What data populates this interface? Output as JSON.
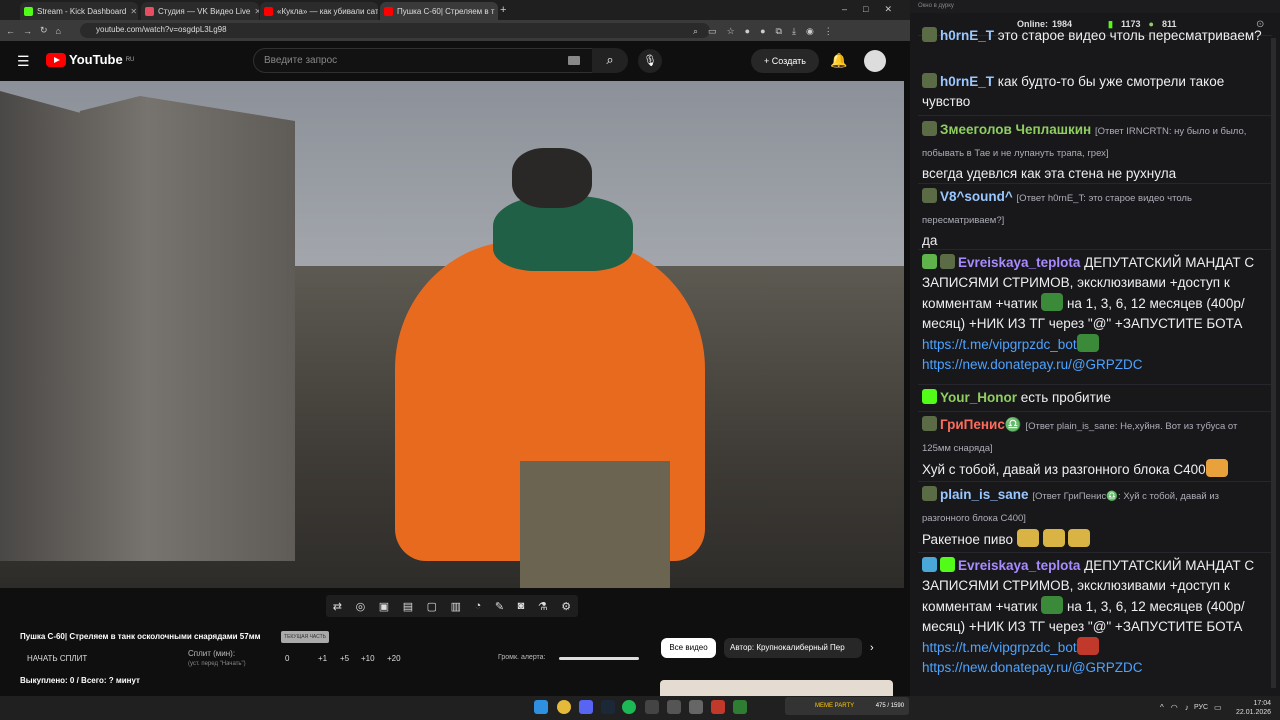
{
  "browser": {
    "tabs": [
      {
        "label": "Stream - Kick Dashboard",
        "color": "#53fc18",
        "active": false
      },
      {
        "label": "Студия — VK Видео Live",
        "color": "#e84d61",
        "active": false
      },
      {
        "label": "«Кукла» — как убивали сатир",
        "color": "#ff0000",
        "active": false
      },
      {
        "label": "Пушка С-60| Стреляем в т",
        "color": "#ff0000",
        "active": true
      }
    ],
    "url": "youtube.com/watch?v=osgdpL3Lg98"
  },
  "youtube": {
    "logo": "YouTube",
    "region": "RU",
    "search_placeholder": "Введите запрос",
    "create_label": "Создать"
  },
  "panel": {
    "title": "Пушка С-60| Стреляем в танк осколочными снарядами 57мм",
    "badge": "ТЕКУЩАЯ ЧАСТЬ",
    "split_button": "НАЧАТЬ СПЛИТ",
    "split_label": "Сплит (мин):",
    "split_hint": "(уст. перед \"Начать\")",
    "split_value": "0",
    "increments": [
      "+1",
      "+5",
      "+10",
      "+20"
    ],
    "alert_label": "Громк. алерта:",
    "bought": "Выкуплено: 0 / Всего: ? минут",
    "chip_all": "Все видео",
    "chip_author": "Автор: Крупнокалиберный Пер",
    "progress_alert": 1.0
  },
  "chat": {
    "window_title": "Окно в дурку",
    "online_label": "Online:",
    "online_value": "1984",
    "kick_count": "1173",
    "other_count": "811",
    "messages": [
      {
        "nick": "h0rnE_T",
        "text": "это старое видео чтоль пересматриваем?",
        "nick_color": "#9ac7ff"
      },
      {
        "nick": "h0rnE_T",
        "text": "как будто-то бы уже смотрели такое чувство",
        "nick_color": "#9ac7ff"
      },
      {
        "nick": "Змееголов Чеплашкин",
        "reply": "[Ответ IRNCRTN: ну было и было, побывать в Тае и не лупануть трапа, грех]",
        "text": "всегда удевлся как эта стена не рухнула",
        "nick_color": "#8fce5f"
      },
      {
        "nick": "V8^sound^",
        "reply": "[Ответ h0rnE_T: это старое видео чтоль пересматриваем?]",
        "text": "да",
        "nick_color": "#9ac7ff"
      },
      {
        "nick": "Evreiskaya_teplota",
        "text": "ДЕПУТАТСКИЙ МАНДАТ С ЗАПИСЯМИ СТРИМОВ, эксклюзивами +доступ к комментам +чатик",
        "text2": "на 1, 3, 6, 12 месяцев (400р/месяц) +НИК ИЗ ТГ через \"@\" +ЗАПУСТИТЕ БОТА",
        "link1": "https://t.me/vipgrpzdc_bot",
        "link2": "https://new.donatepay.ru/@GRPZDC",
        "nick_color": "#a88bff"
      },
      {
        "nick": "Your_Honor",
        "text": "есть пробитие",
        "nick_color": "#8fce5f"
      },
      {
        "nick": "ГриПенис♎",
        "reply": "[Ответ plain_is_sane: Не,хуйня. Вот из тубуса от 125мм снаряда]",
        "text": "Хуй с тобой, давай из разгонного блока С400",
        "nick_color": "#ff6b5b"
      },
      {
        "nick": "plain_is_sane",
        "reply": "[Ответ ГриПенис♎: Хуй с тобой, давай из разгонного блока С400]",
        "text": "Ракетное пиво",
        "nick_color": "#9ac7ff"
      },
      {
        "nick": "Evreiskaya_teplota",
        "text": "ДЕПУТАТСКИЙ МАНДАТ С ЗАПИСЯМИ СТРИМОВ, эксклюзивами +доступ к комментам +чатик",
        "text2": "на 1, 3, 6, 12 месяцев (400р/месяц) +НИК ИЗ ТГ через \"@\" +ЗАПУСТИТЕ БОТА",
        "link1": "https://t.me/vipgrpzdc_bot",
        "link2": "https://new.donatepay.ru/@GRPZDC",
        "nick_color": "#a88bff"
      }
    ]
  },
  "taskbar": {
    "lang": "РУС",
    "time": "17:04",
    "date": "22.01.2026",
    "meme_label": "MEME PARTY",
    "meme_counter": "475 / 1590"
  }
}
